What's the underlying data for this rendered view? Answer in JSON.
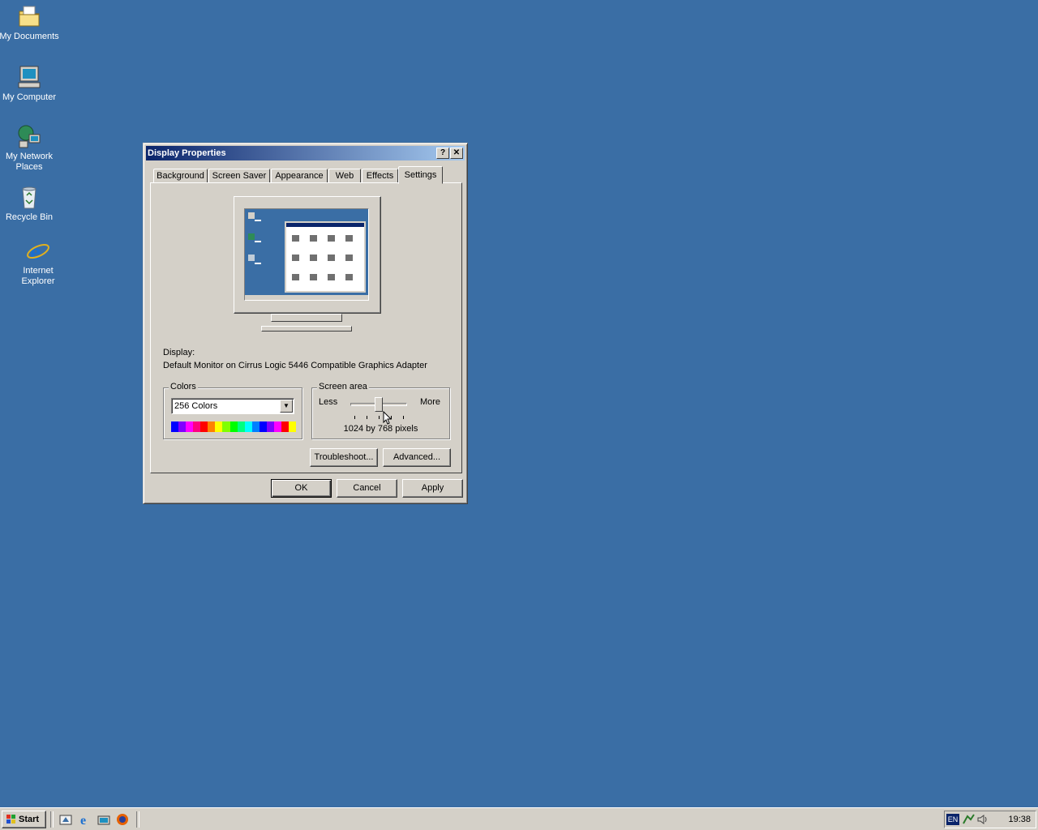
{
  "desktop": {
    "background_color": "#3a6ea5",
    "icons": [
      {
        "label": "My Documents",
        "icon": "folder-documents-icon"
      },
      {
        "label": "My Computer",
        "icon": "computer-icon"
      },
      {
        "label": "My Network Places",
        "icon": "network-places-icon"
      },
      {
        "label": "Recycle Bin",
        "icon": "recycle-bin-icon"
      },
      {
        "label": "Internet Explorer",
        "icon": "internet-explorer-icon"
      }
    ]
  },
  "dialog": {
    "title": "Display Properties",
    "help_glyph": "?",
    "close_glyph": "✕",
    "tabs": [
      {
        "label": "Background"
      },
      {
        "label": "Screen Saver"
      },
      {
        "label": "Appearance"
      },
      {
        "label": "Web"
      },
      {
        "label": "Effects"
      },
      {
        "label": "Settings"
      }
    ],
    "active_tab": "Settings",
    "display_label": "Display:",
    "display_value": "Default Monitor on Cirrus Logic 5446 Compatible Graphics Adapter",
    "colors": {
      "group_title": "Colors",
      "selected": "256 Colors",
      "palette": [
        "#0000ff",
        "#8000ff",
        "#ff00ff",
        "#ff0080",
        "#ff0000",
        "#ff8000",
        "#ffff00",
        "#80ff00",
        "#00ff00",
        "#00ff80",
        "#00ffff",
        "#0080ff",
        "#0000ff",
        "#8000ff",
        "#ff00ff",
        "#ff0000",
        "#ffff00"
      ]
    },
    "screen_area": {
      "group_title": "Screen area",
      "less_label": "Less",
      "more_label": "More",
      "resolution_text": "1024 by 768 pixels",
      "slider_level": 0.5
    },
    "buttons": {
      "troubleshoot": "Troubleshoot...",
      "advanced": "Advanced...",
      "ok": "OK",
      "cancel": "Cancel",
      "apply": "Apply"
    }
  },
  "taskbar": {
    "start_label": "Start",
    "quick_launch": [
      "show-desktop-icon",
      "internet-explorer-icon",
      "launch-icon",
      "firefox-icon"
    ],
    "language": "EN",
    "clock": "19:38"
  }
}
